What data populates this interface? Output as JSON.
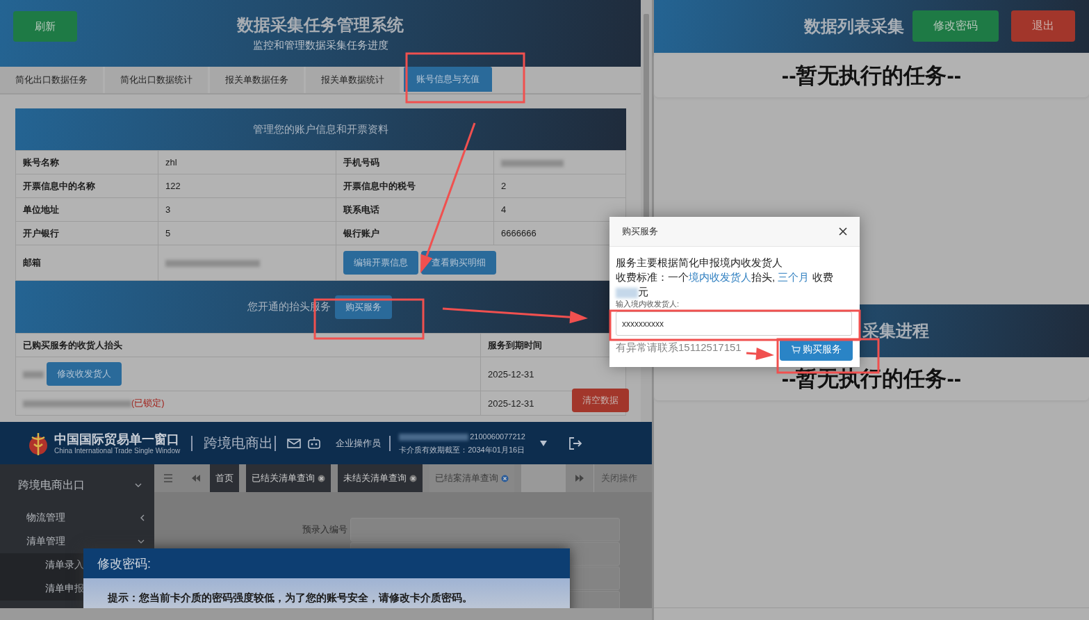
{
  "app": {
    "refresh_button": "刷新",
    "title": "数据采集任务管理系统",
    "subtitle": "监控和管理数据采集任务进度",
    "tabs": [
      {
        "label": "简化出口数据任务",
        "selected": false
      },
      {
        "label": "简化出口数据统计",
        "selected": false
      },
      {
        "label": "报关单数据任务",
        "selected": false
      },
      {
        "label": "报关单数据统计",
        "selected": false
      },
      {
        "label": "账号信息与充值",
        "selected": true
      }
    ],
    "account": {
      "heading": "管理您的账户信息和开票资料",
      "rows": [
        {
          "cells": [
            {
              "kind": "label",
              "text": "账号名称"
            },
            {
              "kind": "value",
              "text": "zhl"
            },
            {
              "kind": "label",
              "text": "手机号码"
            },
            {
              "kind": "redacted"
            }
          ]
        },
        {
          "cells": [
            {
              "kind": "label",
              "text": "开票信息中的名称"
            },
            {
              "kind": "value",
              "text": "122"
            },
            {
              "kind": "label",
              "text": "开票信息中的税号"
            },
            {
              "kind": "value",
              "text": "2"
            }
          ]
        },
        {
          "cells": [
            {
              "kind": "label",
              "text": "单位地址"
            },
            {
              "kind": "value",
              "text": "3"
            },
            {
              "kind": "label",
              "text": "联系电话"
            },
            {
              "kind": "value",
              "text": "4"
            }
          ]
        },
        {
          "cells": [
            {
              "kind": "label",
              "text": "开户银行"
            },
            {
              "kind": "value",
              "text": "5"
            },
            {
              "kind": "label",
              "text": "银行账户"
            },
            {
              "kind": "value",
              "text": "6666666"
            }
          ]
        },
        {
          "cells": [
            {
              "kind": "label",
              "text": "邮箱"
            },
            {
              "kind": "redacted"
            },
            {
              "kind": "buttons",
              "colspan": 2,
              "buttons": [
                "编辑开票信息",
                "查看购买明细"
              ]
            }
          ]
        }
      ]
    },
    "services": {
      "heading": "您开通的抬头服务",
      "buy_button": "购买服务",
      "columns": [
        "已购买服务的收货人抬头",
        "服务到期时间"
      ],
      "rows": [
        {
          "kind": "editable",
          "button": "修改收发货人",
          "expiry": "2025-12-31"
        },
        {
          "kind": "locked",
          "note": "(已锁定)",
          "expiry": "2025-12-31"
        }
      ],
      "clear_button": "清空数据"
    }
  },
  "single_window": {
    "logo_title": "中国国际贸易单一窗口",
    "logo_subtitle": "China International Trade Single Window",
    "module": "跨境电商出",
    "operator": "企业操作员",
    "card_number": "2100060077212",
    "card_expiry": "卡介质有效期截至：2034年01月16日",
    "sidebar": {
      "label": "跨境电商出口",
      "expanded": true,
      "children": [
        {
          "label": "物流管理",
          "expanded": false
        },
        {
          "label": "清单管理",
          "expanded": true,
          "children": [
            {
              "label": "清单录入"
            },
            {
              "label": "清单申报"
            }
          ]
        }
      ]
    },
    "tabs": [
      {
        "label": "首页",
        "closable": false,
        "selected": false
      },
      {
        "label": "已结关清单查询",
        "closable": true,
        "selected": false
      },
      {
        "label": "未结关清单查询",
        "closable": true,
        "selected": false
      },
      {
        "label": "已结案清单查询",
        "closable": true,
        "selected": true
      }
    ],
    "close_ops": "关闭操作",
    "form_label": "预录入编号",
    "password_dialog": {
      "title": "修改密码:",
      "tip": "提示：您当前卡介质的密码强度较低，为了您的账号安全，请修改卡介质密码。"
    }
  },
  "right": {
    "title": "数据列表采集",
    "buttons": [
      {
        "label": "修改密码",
        "kind": "success"
      },
      {
        "label": "退出",
        "kind": "danger"
      }
    ],
    "task_card": "--暂无执行的任务--",
    "progress_title": "采集进程",
    "progress_card": "--暂无执行的任务--"
  },
  "dialog": {
    "title": "购买服务",
    "line_1": "服务主要根据简化申报境内收发货人",
    "fee_line": [
      {
        "kind": "plain",
        "text": "收费标准：一个"
      },
      {
        "kind": "highlight",
        "text": "境内收发货人"
      },
      {
        "kind": "plain",
        "text": "抬头, "
      },
      {
        "kind": "highlight",
        "text": "三个月"
      },
      {
        "kind": "plain",
        "text": " 收费"
      },
      {
        "kind": "redacted"
      },
      {
        "kind": "plain",
        "text": "元"
      }
    ],
    "input_label": "输入境内收发货人:",
    "input_value": "xxxxxxxxxx",
    "hint": "有异常请联系15112517151",
    "buy_button": "购买服务"
  }
}
